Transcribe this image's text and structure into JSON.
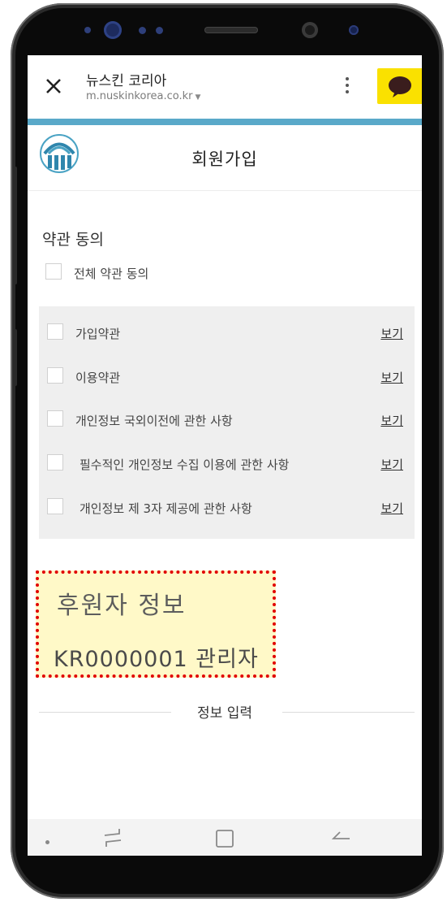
{
  "browser": {
    "site_name": "뉴스킨 코리아",
    "url": "m.nuskinkorea.co.kr",
    "url_caret": "▼",
    "colors": {
      "kakao_yellow": "#fae100",
      "accent_teal": "#5aa9c9"
    },
    "icons": [
      "close-icon",
      "more-vert-icon",
      "kakao-talk-icon"
    ]
  },
  "header": {
    "title": "회원가입",
    "logo_icon": "nuskin-logo-icon"
  },
  "terms": {
    "section_title": "약관 동의",
    "agree_all_label": "전체 약관 동의",
    "view_label": "보기",
    "items": [
      {
        "label": "가입약관"
      },
      {
        "label": "이용약관"
      },
      {
        "label": "개인정보 국외이전에 관한 사항"
      },
      {
        "label": "필수적인 개인정보 수집 이용에 관한 사항"
      },
      {
        "label": "개인정보 제 3자 제공에 관한 사항"
      }
    ]
  },
  "sponsor": {
    "title": "후원자 정보",
    "value": "KR0000001 관리자"
  },
  "info_input": {
    "label": "정보 입력"
  },
  "nav": {
    "icons": [
      "recent-apps-icon",
      "home-icon",
      "back-icon"
    ]
  }
}
